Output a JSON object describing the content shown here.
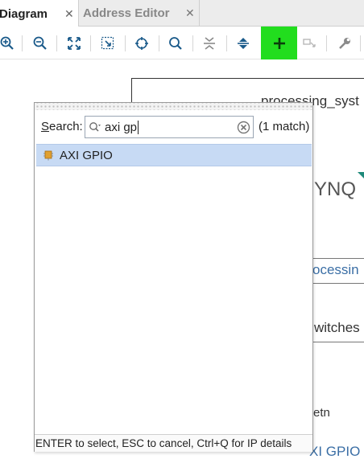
{
  "tabs": [
    {
      "label": "Diagram",
      "active": true
    },
    {
      "label": "Address Editor",
      "active": false
    }
  ],
  "toolbar": {
    "buttons": [
      "zoom-in-icon",
      "zoom-out-icon",
      "zoom-fit-icon",
      "zoom-area-icon",
      "target-icon",
      "search-icon",
      "collapse-icon",
      "expand-icon",
      "add-ip-icon",
      "auto-connect-icon",
      "wrench-icon"
    ],
    "add_button_color": "#22dd1e"
  },
  "canvas": {
    "block_title": "processing_syst",
    "logo_fragment": "YNQ",
    "label_processing": "ocessin",
    "label_switches": "witches",
    "label_rstn": "etn",
    "label_axigpio": "XI GPIO"
  },
  "popup": {
    "search_label_underlined": "S",
    "search_label_rest": "earch:",
    "search_value": "axi gp",
    "match_count": "(1 match)",
    "results": [
      {
        "label": "AXI GPIO",
        "icon": "ip-core-icon",
        "selected": true
      }
    ],
    "footer": "ENTER to select, ESC to cancel, Ctrl+Q for IP details"
  }
}
